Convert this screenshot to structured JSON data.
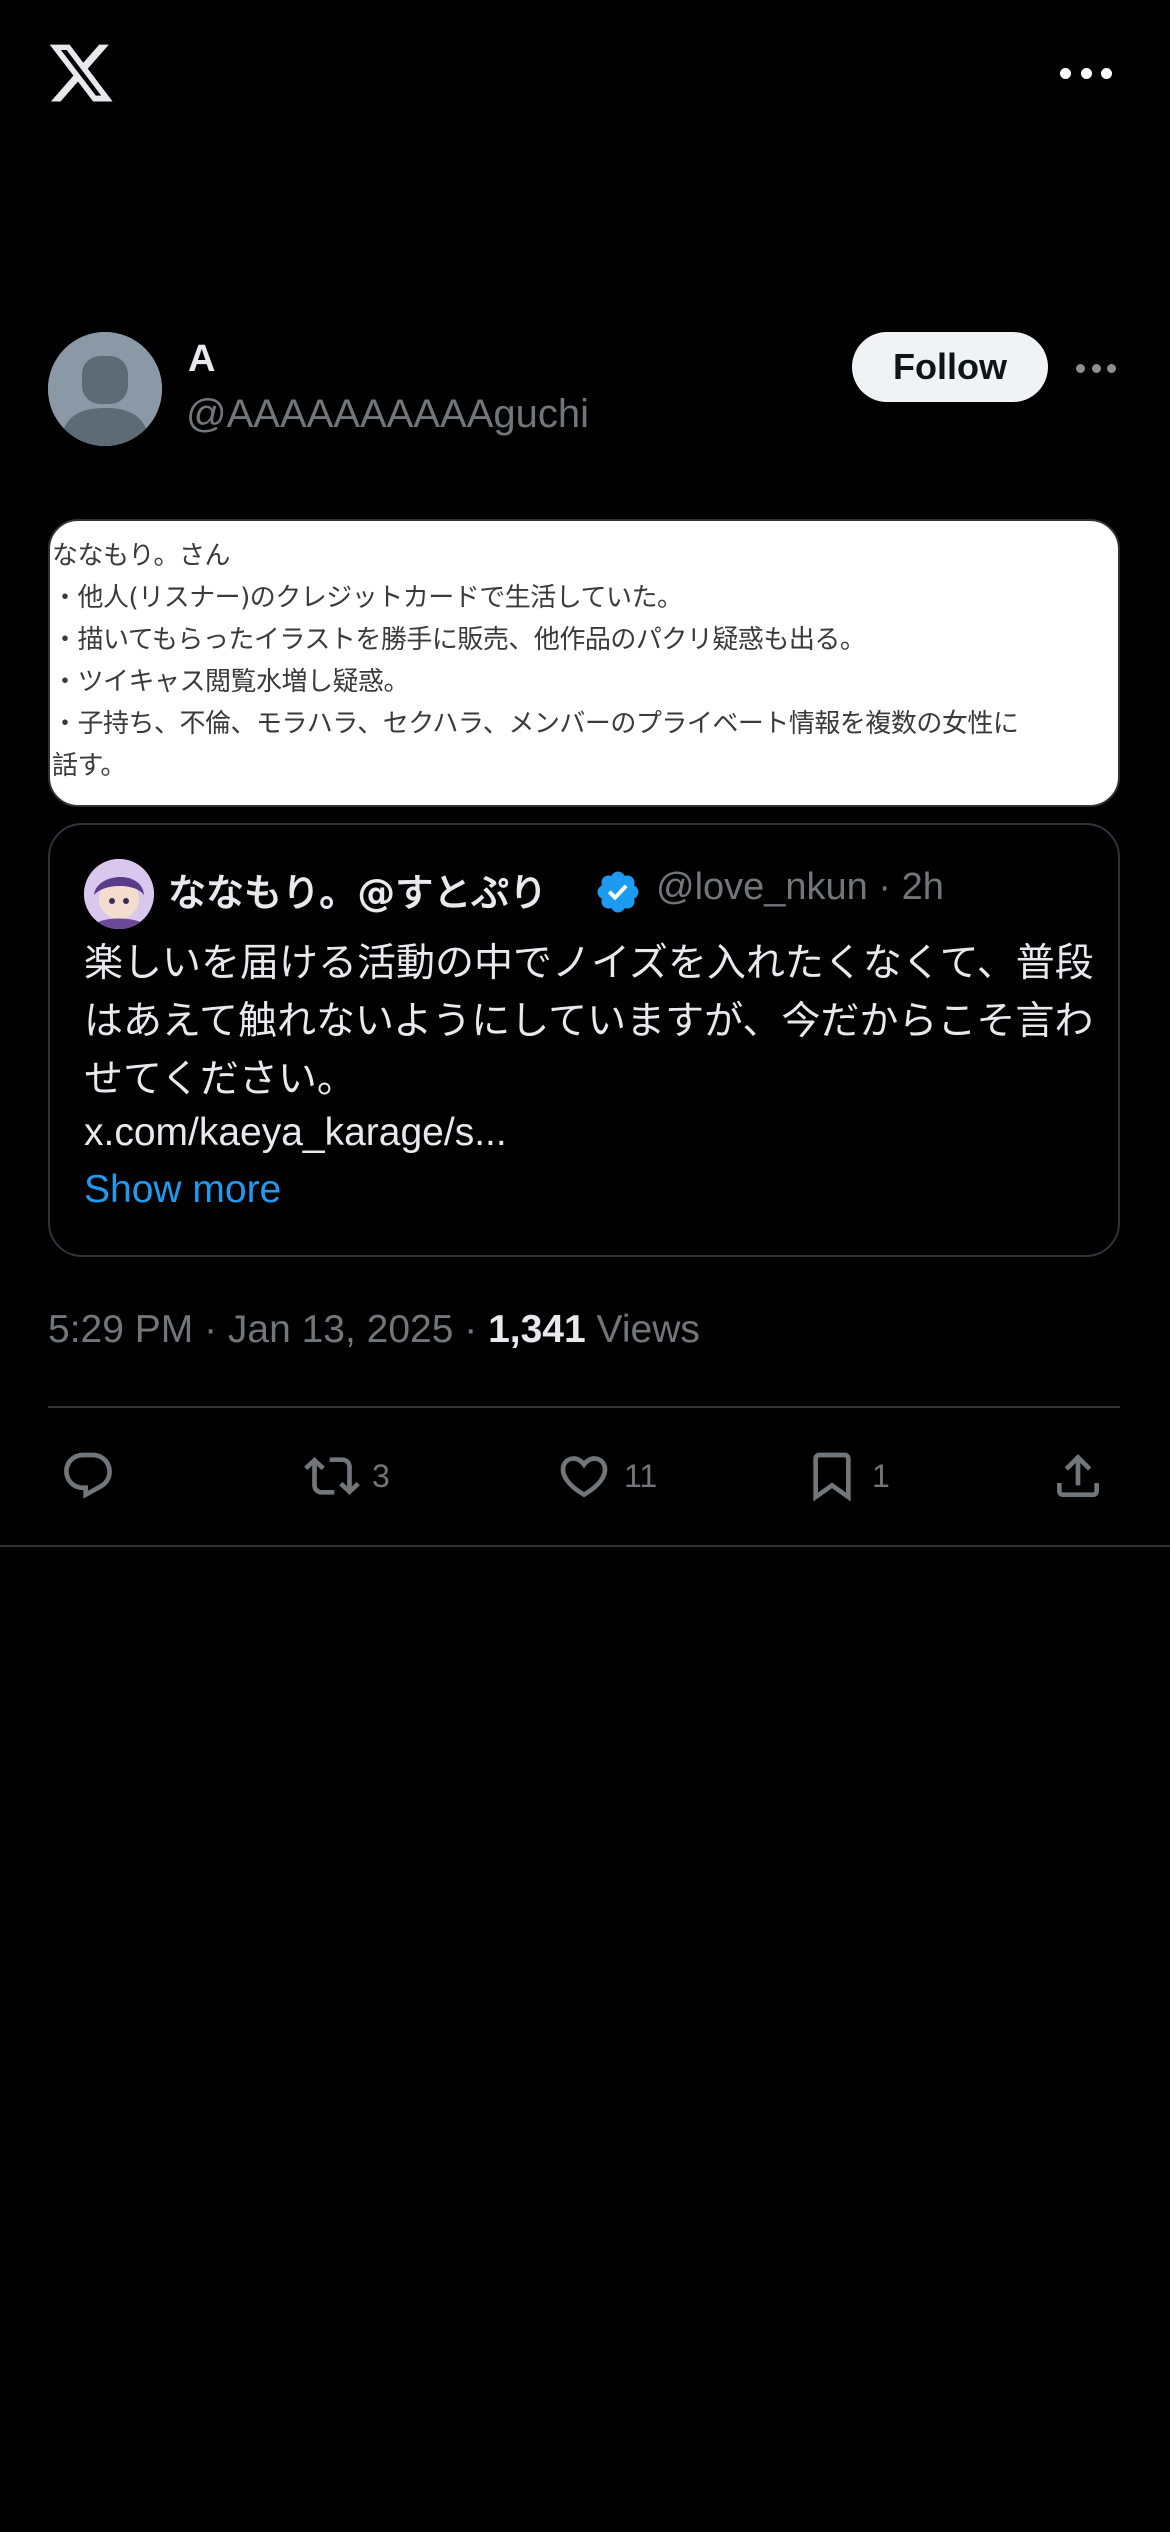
{
  "topbar": {
    "logo_icon": "x-logo-icon",
    "more_icon": "more-horizontal-icon"
  },
  "author": {
    "name": "A",
    "handle": "@AAAAAAAAAAguchi",
    "follow_label": "Follow",
    "avatar_icon": "default-avatar-icon"
  },
  "media": {
    "lines": [
      "ななもり。さん",
      "・他人(リスナー)のクレジットカードで生活していた。",
      "・描いてもらったイラストを勝手に販売、他作品のパクリ疑惑も出る。",
      "・ツイキャス閲覧水増し疑惑。",
      "・子持ち、不倫、モラハラ、セクハラ、メンバーのプライベート情報を複数の女性に",
      "話す。"
    ]
  },
  "quote": {
    "name": "ななもり。@すとぷり",
    "handle_time": "@love_nkun · 2h",
    "text": "楽しいを届ける活動の中でノイズを入れたくなくて、普段はあえて触れないようにしていますが、今だからこそ言わせてください。",
    "link": "x.com/kaeya_karage/s...",
    "show_more": "Show more",
    "verified_color": "#1d9bf0"
  },
  "meta": {
    "time_date": "5:29 PM · Jan 13, 2025 · ",
    "views_count": "1,341",
    "views_label": " Views"
  },
  "actions": {
    "reply": {
      "icon": "reply-icon",
      "count": ""
    },
    "repost": {
      "icon": "repost-icon",
      "count": "3"
    },
    "like": {
      "icon": "heart-icon",
      "count": "11"
    },
    "bookmark": {
      "icon": "bookmark-icon",
      "count": "1"
    },
    "share": {
      "icon": "share-icon"
    }
  },
  "colors": {
    "background": "#000000",
    "accent": "#1d9bf0",
    "muted": "#71767b",
    "text": "#e7e9ea"
  }
}
